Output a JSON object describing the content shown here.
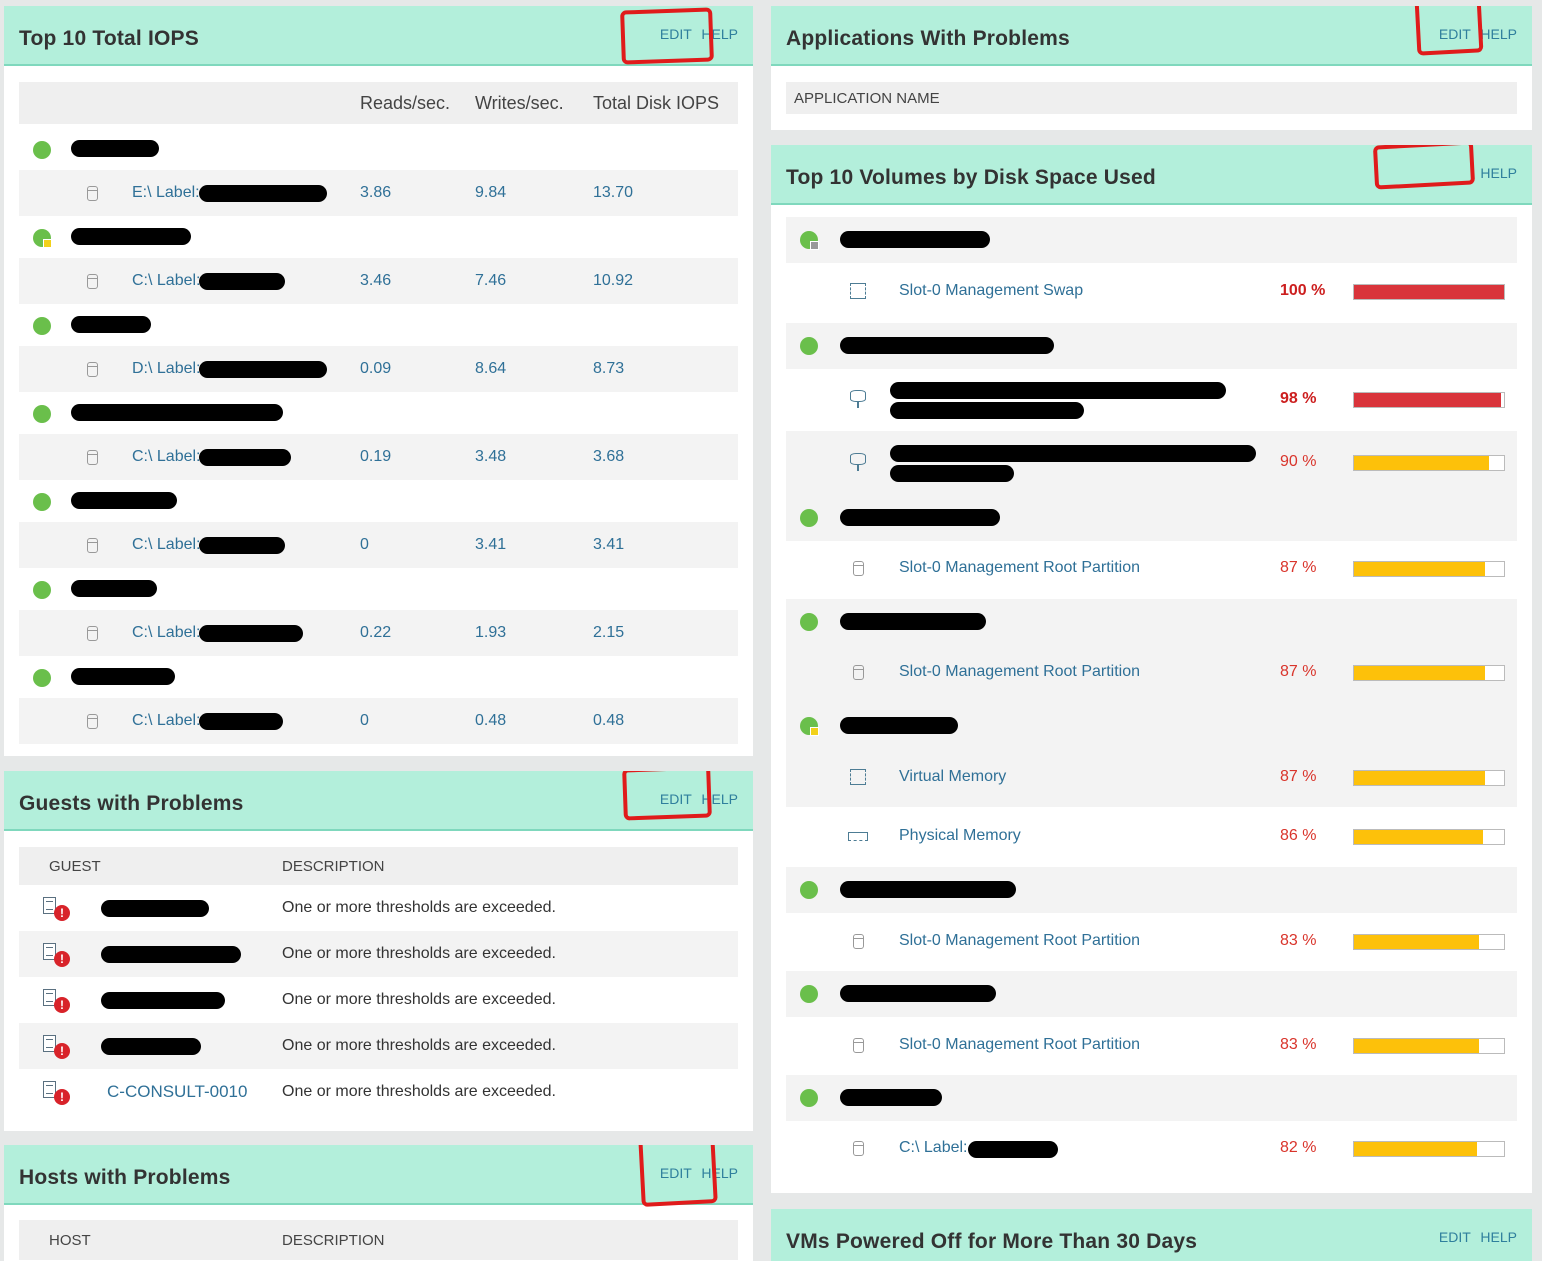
{
  "iops": {
    "title": "Top 10 Total IOPS",
    "edit": "EDIT",
    "help": "HELP",
    "columns": [
      "Reads/sec.",
      "Writes/sec.",
      "Total Disk IOPS"
    ],
    "rows": [
      {
        "label": "E:\\ Label:",
        "reads": "3.86",
        "writes": "9.84",
        "total": "13.70"
      },
      {
        "label": "C:\\ Label:",
        "reads": "3.46",
        "writes": "7.46",
        "total": "10.92"
      },
      {
        "label": "D:\\ Label:",
        "reads": "0.09",
        "writes": "8.64",
        "total": "8.73"
      },
      {
        "label": "C:\\ Label:",
        "reads": "0.19",
        "writes": "3.48",
        "total": "3.68"
      },
      {
        "label": "C:\\ Label:",
        "reads": "0",
        "writes": "3.41",
        "total": "3.41"
      },
      {
        "label": "C:\\ Label:",
        "reads": "0.22",
        "writes": "1.93",
        "total": "2.15"
      },
      {
        "label": "C:\\ Label:",
        "reads": "0",
        "writes": "0.48",
        "total": "0.48"
      }
    ]
  },
  "guests": {
    "title": "Guests with Problems",
    "edit": "EDIT",
    "help": "HELP",
    "col_guest": "GUEST",
    "col_desc": "DESCRIPTION",
    "rows": [
      {
        "name": "",
        "desc": "One or more thresholds are exceeded."
      },
      {
        "name": "",
        "desc": "One or more thresholds are exceeded."
      },
      {
        "name": "",
        "desc": "One or more thresholds are exceeded."
      },
      {
        "name": "",
        "desc": "One or more thresholds are exceeded."
      },
      {
        "name": "C-CONSULT-0010",
        "desc": "One or more thresholds are exceeded."
      }
    ]
  },
  "hosts": {
    "title": "Hosts with Problems",
    "edit": "EDIT",
    "help": "HELP",
    "col_host": "HOST",
    "col_desc": "DESCRIPTION"
  },
  "apps": {
    "title": "Applications With Problems",
    "edit": "EDIT",
    "help": "HELP",
    "col_name": "APPLICATION NAME"
  },
  "volumes": {
    "title": "Top 10 Volumes by Disk Space Used",
    "help": "HELP",
    "rows": [
      {
        "label": "Slot-0 Management Swap",
        "percent": 100,
        "pct_text": "100 %",
        "icon": "memory-icon"
      },
      {
        "label": "",
        "percent": 98,
        "pct_text": "98 %",
        "icon": "network-storage-icon"
      },
      {
        "label": "",
        "percent": 90,
        "pct_text": "90 %",
        "icon": "network-storage-icon"
      },
      {
        "label": "Slot-0 Management Root Partition",
        "percent": 87,
        "pct_text": "87 %",
        "icon": "disk-icon"
      },
      {
        "label": "Slot-0 Management Root Partition",
        "percent": 87,
        "pct_text": "87 %",
        "icon": "disk-icon"
      },
      {
        "label": "Virtual Memory",
        "percent": 87,
        "pct_text": "87 %",
        "icon": "memory-icon"
      },
      {
        "label": "Physical Memory",
        "percent": 86,
        "pct_text": "86 %",
        "icon": "ram-icon"
      },
      {
        "label": "Slot-0 Management Root Partition",
        "percent": 83,
        "pct_text": "83 %",
        "icon": "disk-icon"
      },
      {
        "label": "Slot-0 Management Root Partition",
        "percent": 83,
        "pct_text": "83 %",
        "icon": "disk-icon"
      },
      {
        "label": "C:\\ Label:",
        "percent": 82,
        "pct_text": "82 %",
        "icon": "disk-icon"
      }
    ]
  },
  "vms_off": {
    "title": "VMs Powered Off for More Than 30 Days",
    "edit": "EDIT",
    "help": "HELP"
  },
  "colors": {
    "header_bg": "#b3efdb",
    "status_ok": "#6abf4b",
    "bar_critical": "#d9343b",
    "bar_warning": "#fdc10a",
    "link": "#2f7097",
    "annotation": "#e01b1b"
  }
}
